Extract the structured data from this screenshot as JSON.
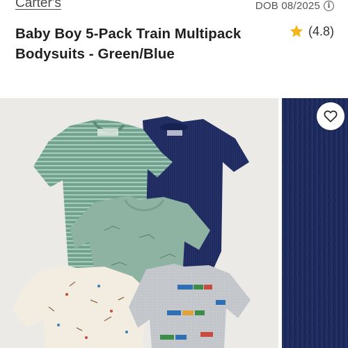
{
  "header": {
    "brand": "Carter's",
    "dob": "DOB 08/2025"
  },
  "product": {
    "title": "Baby Boy 5-Pack Train Multipack Bodysuits - Green/Blue",
    "rating_text": "(4.8)",
    "rating_value": 4.8
  },
  "icons": {
    "info": "info-icon",
    "star": "star-icon",
    "heart": "heart-icon"
  },
  "colors": {
    "star": "#f3b51c",
    "navy": "#1e2a5e",
    "green": "#6fa28e",
    "sage": "#8fb3a3",
    "cream": "#f3ece0",
    "gray": "#c7c9cc"
  }
}
